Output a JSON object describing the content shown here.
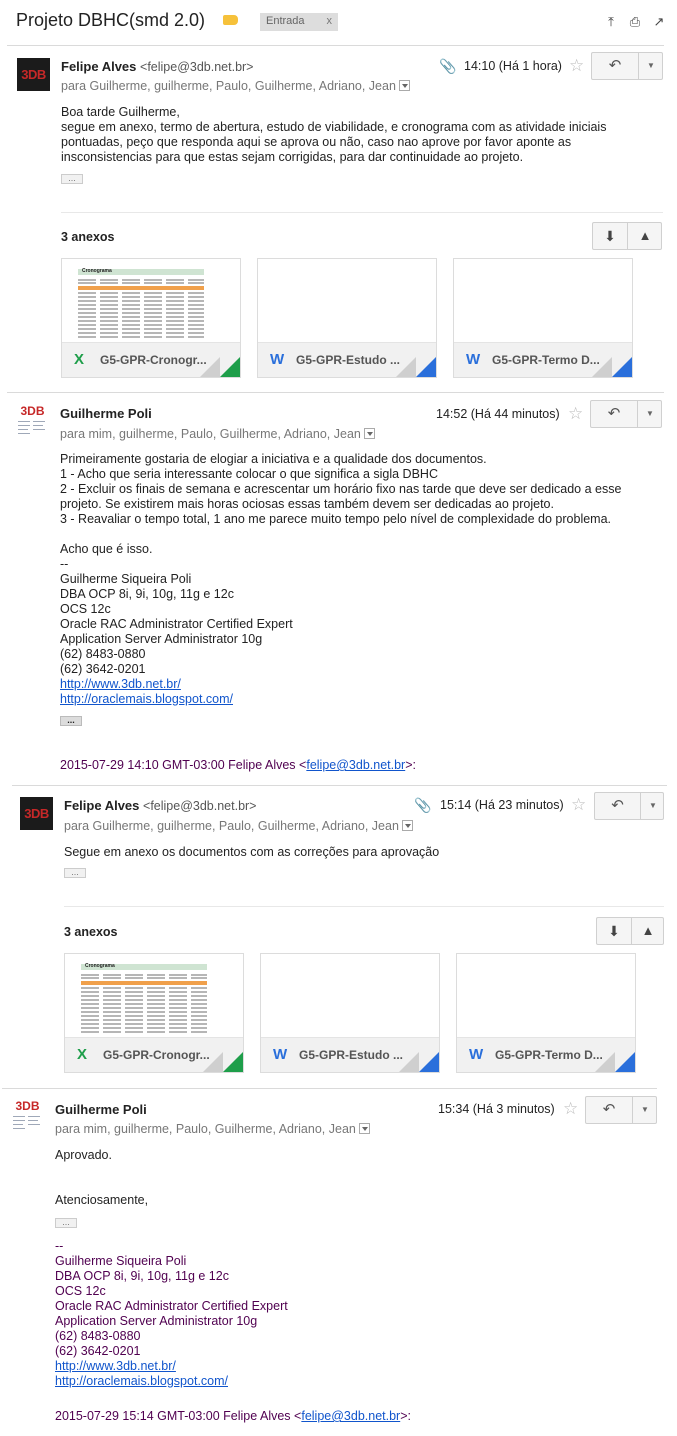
{
  "thread": {
    "subject": "Projeto DBHC(smd 2.0)",
    "label_color": "#f6c13a",
    "inbox_chip": {
      "label": "Entrada",
      "remove": "x"
    },
    "top_icons": [
      "expand-all-icon",
      "print-icon",
      "new-window-icon"
    ]
  },
  "messages": [
    {
      "sender": "Felipe Alves",
      "email": "<felipe@3db.net.br>",
      "recipients": "para Guilherme, guilherme, Paulo, Guilherme, Adriano, Jean",
      "time": "14:10 (Há 1 hora)",
      "has_attachment_icon": true,
      "body": [
        "Boa tarde Guilherme,",
        "segue em anexo, termo de abertura, estudo de viabilidade, e cronograma com as atividade iniciais",
        "pontuadas, peço que responda aqui se aprova ou não, caso nao aprove por favor aponte as",
        "insconsistencias para que estas sejam corrigidas, para dar continuidade ao projeto."
      ],
      "attachments_title": "3 anexos",
      "attachments": [
        {
          "name": "G5-GPR-Cronogr...",
          "type": "xls",
          "icon": "X"
        },
        {
          "name": "G5-GPR-Estudo ...",
          "type": "doc",
          "icon": "W"
        },
        {
          "name": "G5-GPR-Termo D...",
          "type": "doc",
          "icon": "W"
        }
      ]
    },
    {
      "sender": "Guilherme Poli",
      "recipients": "para mim, guilherme, Paulo, Guilherme, Adriano, Jean",
      "time": "14:52 (Há 44 minutos)",
      "body": [
        "Primeiramente gostaria de elogiar a iniciativa e a qualidade dos documentos.",
        "1 - Acho que seria interessante colocar o que significa a sigla DBHC",
        "2 - Excluir os finais de semana e acrescentar um horário fixo nas tarde que deve ser dedicado a esse",
        "projeto. Se existirem mais horas ociosas essas também devem ser dedicadas ao projeto.",
        "3 - Reavaliar o tempo total, 1 ano me parece muito tempo pelo nível de complexidade do problema.",
        "",
        "Acho que é isso."
      ],
      "signature": [
        "--",
        "Guilherme Siqueira Poli",
        "DBA OCP 8i, 9i, 10g, 11g e 12c",
        "OCS 12c",
        "Oracle RAC Administrator Certified Expert",
        "Application Server Administrator 10g",
        "(62) 8483-0880",
        "(62) 3642-0201"
      ],
      "links": [
        "http://www.3db.net.br/",
        "http://oraclemais.blogspot.com/"
      ],
      "quote_prefix": "2015-07-29 14:10 GMT-03:00 Felipe Alves <",
      "quote_email": "felipe@3db.net.br",
      "quote_suffix": ">:"
    },
    {
      "sender": "Felipe Alves",
      "email": "<felipe@3db.net.br>",
      "recipients": "para Guilherme, guilherme, Paulo, Guilherme, Adriano, Jean",
      "time": "15:14 (Há 23 minutos)",
      "has_attachment_icon": true,
      "body": [
        "Segue em anexo os documentos com as correções para aprovação"
      ],
      "attachments_title": "3 anexos",
      "attachments": [
        {
          "name": "G5-GPR-Cronogr...",
          "type": "xls",
          "icon": "X"
        },
        {
          "name": "G5-GPR-Estudo ...",
          "type": "doc",
          "icon": "W"
        },
        {
          "name": "G5-GPR-Termo D...",
          "type": "doc",
          "icon": "W"
        }
      ]
    },
    {
      "sender": "Guilherme Poli",
      "recipients": "para mim, guilherme, Paulo, Guilherme, Adriano, Jean",
      "time": "15:34 (Há 3 minutos)",
      "body": [
        "Aprovado.",
        "",
        "",
        "Atenciosamente,"
      ],
      "signature": [
        "--",
        "Guilherme Siqueira Poli",
        "DBA OCP 8i, 9i, 10g, 11g e 12c",
        "OCS 12c",
        "Oracle RAC Administrator Certified Expert",
        "Application Server Administrator 10g",
        "(62) 8483-0880",
        "(62) 3642-0201"
      ],
      "links": [
        "http://www.3db.net.br/",
        "http://oraclemais.blogspot.com/"
      ],
      "quote_prefix": "2015-07-29 15:14 GMT-03:00 Felipe Alves <",
      "quote_email": "felipe@3db.net.br",
      "quote_suffix": ">:"
    }
  ],
  "avatar_text": "3DB",
  "colors": {
    "xls_green": "#1e9e4a",
    "doc_blue": "#2a6fdb",
    "link": "#1155cc",
    "quote_purple": "#500050"
  }
}
